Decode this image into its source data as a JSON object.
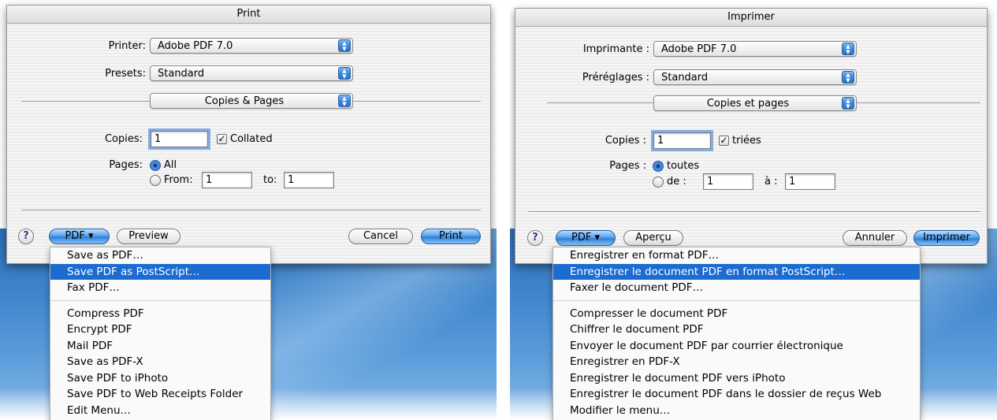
{
  "english": {
    "title": "Print",
    "printer_label": "Printer:",
    "printer_value": "Adobe PDF 7.0",
    "presets_label": "Presets:",
    "presets_value": "Standard",
    "section_value": "Copies & Pages",
    "copies_label": "Copies:",
    "copies_value": "1",
    "collated_label": "Collated",
    "collated_checked": true,
    "pages_label": "Pages:",
    "all_label": "All",
    "from_label": "From:",
    "from_value": "1",
    "to_label": "to:",
    "to_value": "1",
    "help_label": "?",
    "pdf_button": "PDF ▾",
    "preview_button": "Preview",
    "cancel_button": "Cancel",
    "print_button": "Print",
    "menu_items": [
      "Save as PDF…",
      "Save PDF as PostScript…",
      "Fax PDF…",
      "Compress PDF",
      "Encrypt PDF",
      "Mail PDF",
      "Save as PDF-X",
      "Save PDF to iPhoto",
      "Save PDF to Web Receipts Folder",
      "Edit Menu…"
    ],
    "selected_menu_item": "Save PDF as PostScript…"
  },
  "french": {
    "title": "Imprimer",
    "printer_label": "Imprimante :",
    "printer_value": "Adobe PDF 7.0",
    "presets_label": "Préréglages :",
    "presets_value": "Standard",
    "section_value": "Copies et pages",
    "copies_label": "Copies :",
    "copies_value": "1",
    "collated_label": "triées",
    "collated_checked": true,
    "pages_label": "Pages :",
    "all_label": "toutes",
    "from_label": "de :",
    "from_value": "1",
    "to_label": "à :",
    "to_value": "1",
    "help_label": "?",
    "pdf_button": "PDF ▾",
    "preview_button": "Aperçu",
    "cancel_button": "Annuler",
    "print_button": "Imprimer",
    "menu_items": [
      "Enregistrer en format PDF…",
      "Enregistrer le document PDF en format PostScript…",
      "Faxer le document PDF…",
      "Compresser le document PDF",
      "Chiffrer le document PDF",
      "Envoyer le document PDF par courrier électronique",
      "Enregistrer en PDF-X",
      "Enregistrer le document PDF vers iPhoto",
      "Enregistrer le document PDF dans le dossier de reçus Web",
      "Modifier le menu…"
    ],
    "selected_menu_item": "Enregistrer le document PDF en format PostScript…"
  },
  "icons": {
    "popup_arrows": "up-down-arrows-icon",
    "checkmark": "checkmark-icon",
    "help": "help-icon"
  },
  "colors": {
    "accent_blue": "#1b6bd1",
    "desktop_blue": "#3f86cc"
  }
}
